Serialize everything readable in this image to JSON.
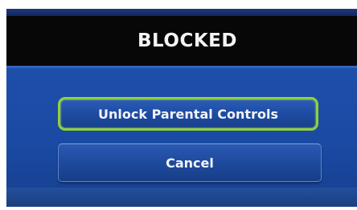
{
  "dialog": {
    "title": "BLOCKED"
  },
  "buttons": {
    "unlock_label": "Unlock Parental Controls",
    "cancel_label": "Cancel"
  },
  "colors": {
    "title_bar": "#070707",
    "panel_blue": "#1a4aa3",
    "focus_outline": "#8fd13a",
    "text": "#f4f4f4"
  }
}
